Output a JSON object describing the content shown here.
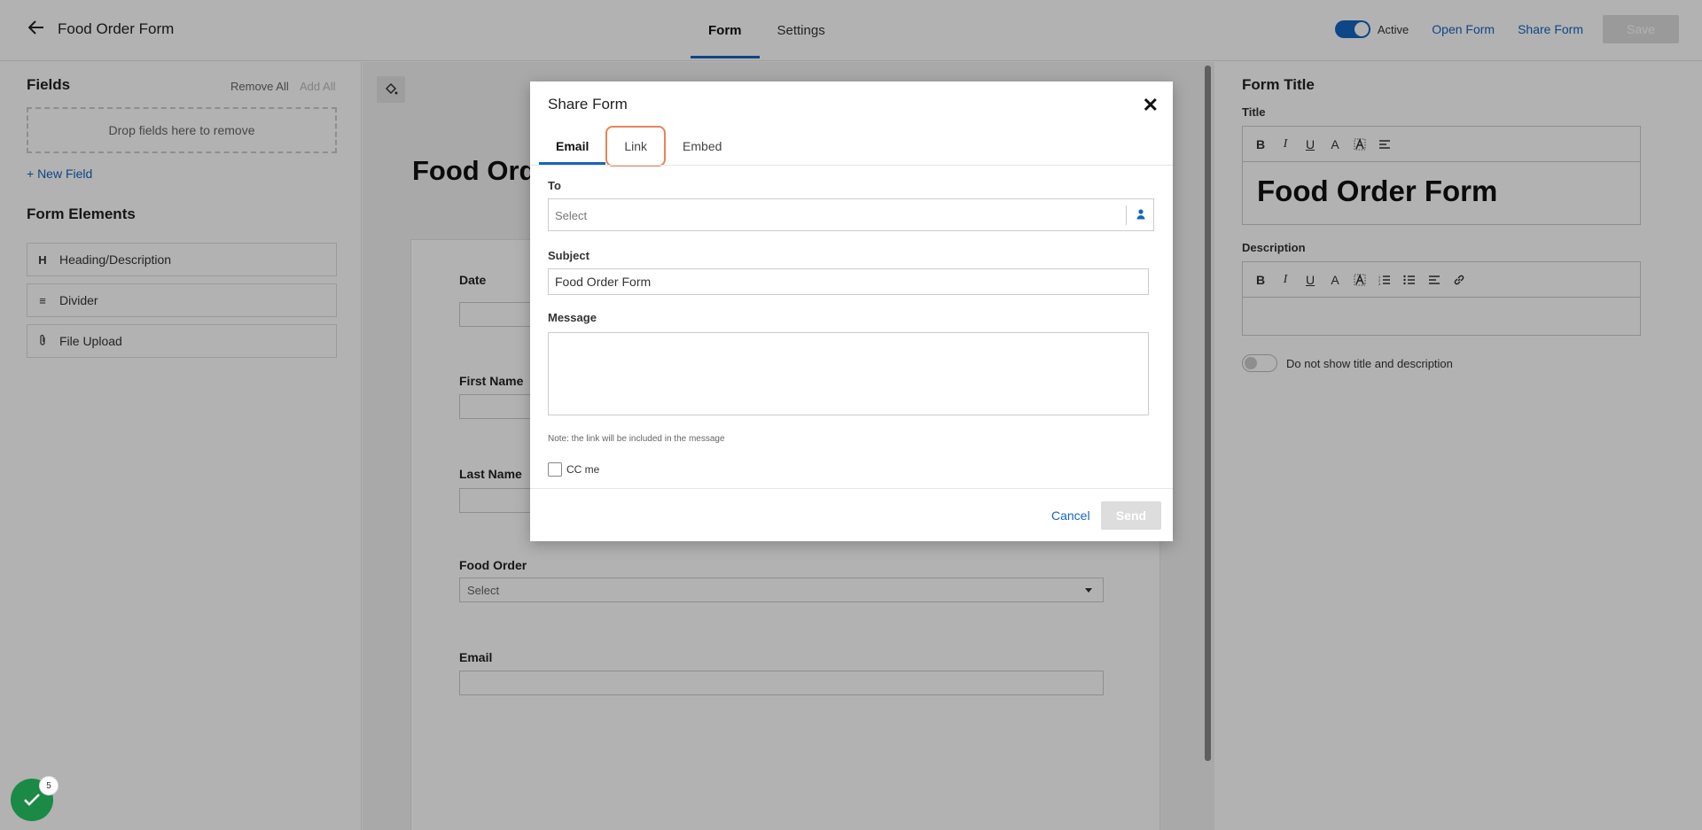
{
  "header": {
    "title": "Food Order Form",
    "tabs": [
      {
        "label": "Form",
        "active": true
      },
      {
        "label": "Settings",
        "active": false
      }
    ],
    "active_label": "Active",
    "open_form": "Open Form",
    "share_form": "Share Form",
    "save": "Save"
  },
  "left": {
    "fields_title": "Fields",
    "remove_all": "Remove All",
    "add_all": "Add All",
    "dropzone": "Drop fields here to remove",
    "new_field": "+ New Field",
    "elements_title": "Form Elements",
    "elements": [
      {
        "icon": "H",
        "label": "Heading/Description"
      },
      {
        "icon": "≡",
        "label": "Divider"
      },
      {
        "icon": "📎",
        "label": "File Upload"
      }
    ]
  },
  "canvas": {
    "heading": "Food Order Form",
    "fields": [
      {
        "label": "Date"
      },
      {
        "label": "First Name"
      },
      {
        "label": "Last Name"
      },
      {
        "label": "Food Order",
        "placeholder": "Select"
      },
      {
        "label": "Email"
      }
    ]
  },
  "right": {
    "title": "Form Title",
    "title_label": "Title",
    "title_value": "Food Order Form",
    "description_label": "Description",
    "hide_toggle_label": "Do not show title and description"
  },
  "modal": {
    "title": "Share Form",
    "tabs": [
      {
        "label": "Email",
        "active": true
      },
      {
        "label": "Link",
        "active": false,
        "highlighted": true
      },
      {
        "label": "Embed",
        "active": false
      }
    ],
    "to_label": "To",
    "to_placeholder": "Select",
    "subject_label": "Subject",
    "subject_value": "Food Order Form",
    "message_label": "Message",
    "note": "Note: the link will be included in the message",
    "cc_label": "CC me",
    "cancel": "Cancel",
    "send": "Send"
  },
  "badge": {
    "count": "5"
  },
  "colors": {
    "accent": "#1565c0",
    "highlight": "#e8845a",
    "success": "#1a8a46"
  }
}
